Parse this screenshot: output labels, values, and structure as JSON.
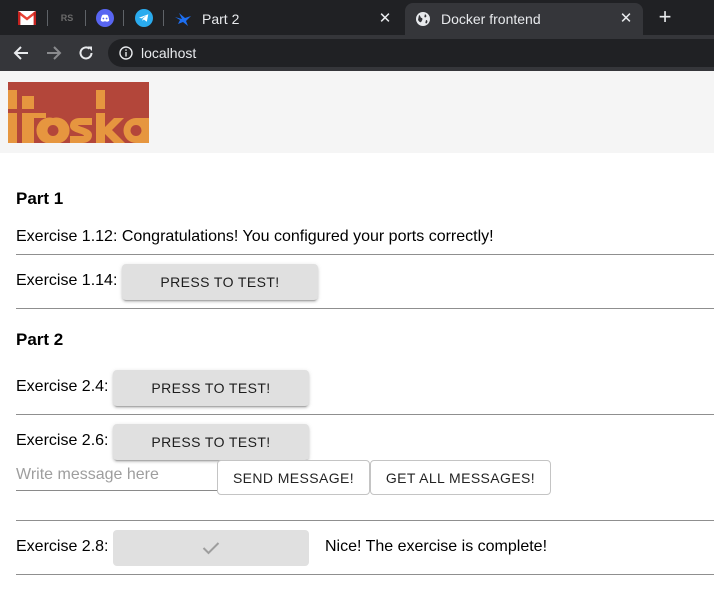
{
  "browser": {
    "pinned_tabs": [
      {
        "icon": "gmail-icon"
      },
      {
        "icon": "rs-icon",
        "text": "RS"
      },
      {
        "icon": "discord-icon"
      },
      {
        "icon": "telegram-icon"
      }
    ],
    "tabs": [
      {
        "title": "Part 2",
        "icon": "bird-icon",
        "active": false
      },
      {
        "title": "Docker frontend",
        "icon": "globe-icon",
        "active": true
      }
    ],
    "close_glyph": "✕",
    "new_tab_glyph": "+",
    "url": "localhost"
  },
  "page": {
    "part1": {
      "heading": "Part 1",
      "ex112_text": "Exercise 1.12: Congratulations! You configured your ports correctly!",
      "ex114_label": "Exercise 1.14:",
      "ex114_button": "PRESS TO TEST!"
    },
    "part2": {
      "heading": "Part 2",
      "ex24_label": "Exercise 2.4:",
      "ex24_button": "PRESS TO TEST!",
      "ex26_label": "Exercise 2.6:",
      "ex26_button": "PRESS TO TEST!",
      "message_placeholder": "Write message here",
      "message_value": "",
      "send_button": "SEND MESSAGE!",
      "get_button": "GET ALL MESSAGES!",
      "ex28_label": "Exercise 2.8:",
      "ex28_status": "Nice! The exercise is complete!"
    }
  },
  "colors": {
    "logo_red": "#b3463a",
    "logo_orange": "#e6963f",
    "gmail_red": "#ea4335",
    "discord": "#5865f2",
    "telegram": "#2aabee",
    "bird_blue": "#1d6ff2"
  }
}
